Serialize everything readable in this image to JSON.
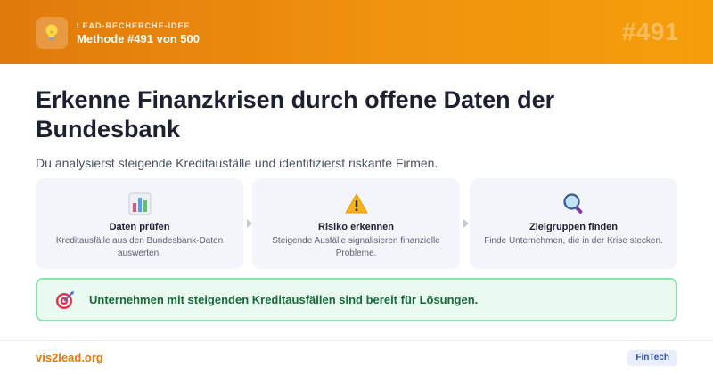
{
  "header": {
    "kicker": "LEAD-RECHERCHE-IDEE",
    "method": "Methode #491 von 500",
    "number": "#491",
    "icon": "lightbulb-icon"
  },
  "main": {
    "title": "Erkenne Finanzkrisen durch offene Daten der Bundesbank",
    "subtitle": "Du analysierst steigende Kreditausfälle und identifizierst riskante Firmen."
  },
  "steps": [
    {
      "icon": "bar-chart-icon",
      "title": "Daten prüfen",
      "text": "Kreditausfälle aus den Bundesbank-Daten auswerten."
    },
    {
      "icon": "warning-icon",
      "title": "Risiko erkennen",
      "text": "Steigende Ausfälle signalisieren finanzielle Probleme."
    },
    {
      "icon": "magnifier-icon",
      "title": "Zielgruppen finden",
      "text": "Finde Unternehmen, die in der Krise stecken."
    }
  ],
  "callout": {
    "icon": "target-icon",
    "text": "Unternehmen mit steigenden Kreditausfällen sind bereit für Lösungen."
  },
  "footer": {
    "link": "vis2lead.org",
    "badge": "FinTech"
  },
  "colors": {
    "header_start": "#e07a0c",
    "header_end": "#f59e0b",
    "callout_bg": "#e9faf0",
    "callout_border": "#8fe0b0",
    "callout_text": "#156a3a",
    "footer_link": "#e07a0c",
    "badge_bg": "#e9eefc",
    "badge_text": "#2f4fa8"
  }
}
